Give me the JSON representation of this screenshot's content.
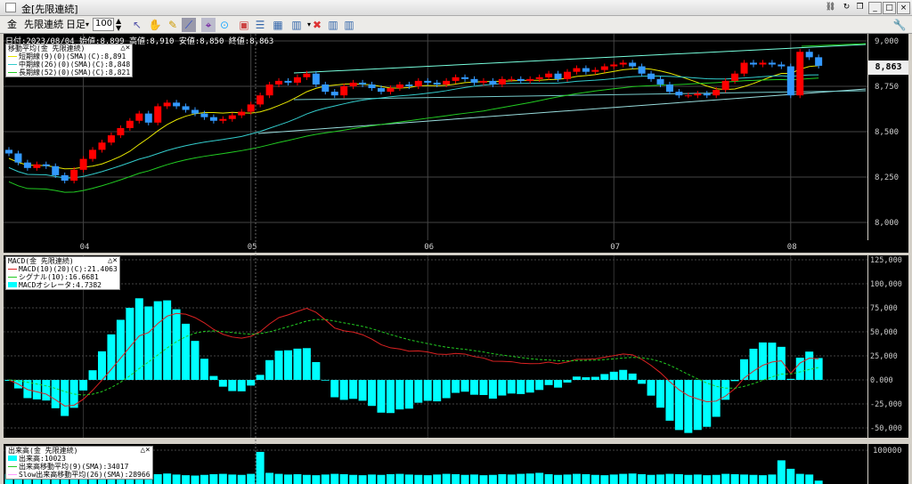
{
  "window": {
    "title": "金[先限連続]",
    "buttons": [
      "minimize",
      "maximize",
      "close"
    ]
  },
  "toolbar": {
    "symbol": "金",
    "contract": "先限連続",
    "period": "日足",
    "bar_count": "100",
    "icons": [
      "select-arrow-icon",
      "hand-icon",
      "pencil-icon",
      "line-draw-icon",
      "crosshair-icon",
      "scroll-icon",
      "chart-frame-icon",
      "horizontal-grid-icon",
      "grid-icon",
      "bar-chart-icon",
      "delete-icon",
      "indicator-icon",
      "indicator2-icon"
    ]
  },
  "info_bar": "日付:2023/08/04 始値:8,899 高値:8,910 安値:8,850 終値:8,863",
  "price_panel": {
    "legend": {
      "title": "移動平均(金 先限連続)",
      "items": [
        {
          "label": "短期線(9)(0)(SMA)(C):8,891",
          "color": "#e6e600"
        },
        {
          "label": "中期線(26)(0)(SMA)(C):8,848",
          "color": "#33cccc"
        },
        {
          "label": "長期線(52)(0)(SMA)(C):8,821",
          "color": "#22cc22"
        }
      ]
    },
    "y_ticks": [
      "9,000",
      "8,750",
      "8,500",
      "8,250",
      "8,000"
    ],
    "y_values": [
      9000,
      8750,
      8500,
      8250,
      8000
    ],
    "current_price": "8,863",
    "x_ticks": [
      "04",
      "05",
      "06",
      "07",
      "08"
    ],
    "x_tick_bars": [
      8,
      26,
      45,
      65,
      84
    ]
  },
  "macd_panel": {
    "legend": {
      "title": "MACD(金 先限連続)",
      "items": [
        {
          "label": "MACD(10)(20)(C):21.4063",
          "color": "#dd2222"
        },
        {
          "label": "シグナル(10):16.6681",
          "color": "#22cc22"
        },
        {
          "label": "MACDオシレータ:4.7382",
          "color": "#00ffff"
        }
      ]
    },
    "y_ticks": [
      "125,000",
      "100,000",
      "75,000",
      "50,000",
      "25,000",
      "0.000",
      "-25,000",
      "-50,000"
    ],
    "y_values": [
      125000,
      100000,
      75000,
      50000,
      25000,
      0,
      -25000,
      -50000
    ]
  },
  "volume_panel": {
    "legend": {
      "title": "出来高(金 先限連続)",
      "items": [
        {
          "label": "出来高:10023",
          "color": "#00ffff"
        },
        {
          "label": "出来高移動平均(9)(SMA):34017",
          "color": "#22cc22"
        },
        {
          "label": "Slow出来高移動平均(26)(SMA):28966",
          "color": "#ff99ff"
        }
      ]
    },
    "y_ticks": [
      "100000"
    ]
  },
  "colors": {
    "up": "#ff0000",
    "down": "#3399ff",
    "grid": "#555555"
  },
  "series": {
    "closes": [
      8380,
      8330,
      8300,
      8320,
      8310,
      8260,
      8230,
      8290,
      8350,
      8400,
      8440,
      8480,
      8520,
      8560,
      8600,
      8550,
      8640,
      8660,
      8640,
      8620,
      8600,
      8580,
      8560,
      8570,
      8590,
      8610,
      8650,
      8700,
      8760,
      8780,
      8770,
      8800,
      8820,
      8760,
      8720,
      8700,
      8750,
      8770,
      8760,
      8740,
      8720,
      8740,
      8760,
      8750,
      8780,
      8770,
      8760,
      8780,
      8800,
      8790,
      8770,
      8780,
      8760,
      8790,
      8790,
      8780,
      8790,
      8800,
      8820,
      8790,
      8830,
      8850,
      8830,
      8840,
      8860,
      8870,
      8880,
      8860,
      8820,
      8790,
      8760,
      8720,
      8700,
      8700,
      8710,
      8700,
      8730,
      8780,
      8820,
      8880,
      8870,
      8880,
      8870,
      8860,
      8700,
      8940,
      8910,
      8863
    ],
    "volumes": [
      30,
      28,
      25,
      26,
      30,
      27,
      32,
      28,
      30,
      29,
      31,
      27,
      28,
      30,
      26,
      27,
      29,
      31,
      28,
      26,
      25,
      27,
      29,
      30,
      28,
      27,
      30,
      95,
      33,
      30,
      28,
      29,
      27,
      26,
      28,
      30,
      29,
      27,
      26,
      28,
      27,
      29,
      30,
      28,
      27,
      26,
      28,
      30,
      29,
      27,
      28,
      26,
      27,
      29,
      28,
      30,
      31,
      33,
      29,
      27,
      28,
      30,
      29,
      27,
      26,
      28,
      30,
      31,
      29,
      27,
      28,
      30,
      29,
      27,
      28,
      26,
      27,
      30,
      29,
      28,
      27,
      26,
      28,
      70,
      45,
      30,
      28,
      10
    ]
  }
}
